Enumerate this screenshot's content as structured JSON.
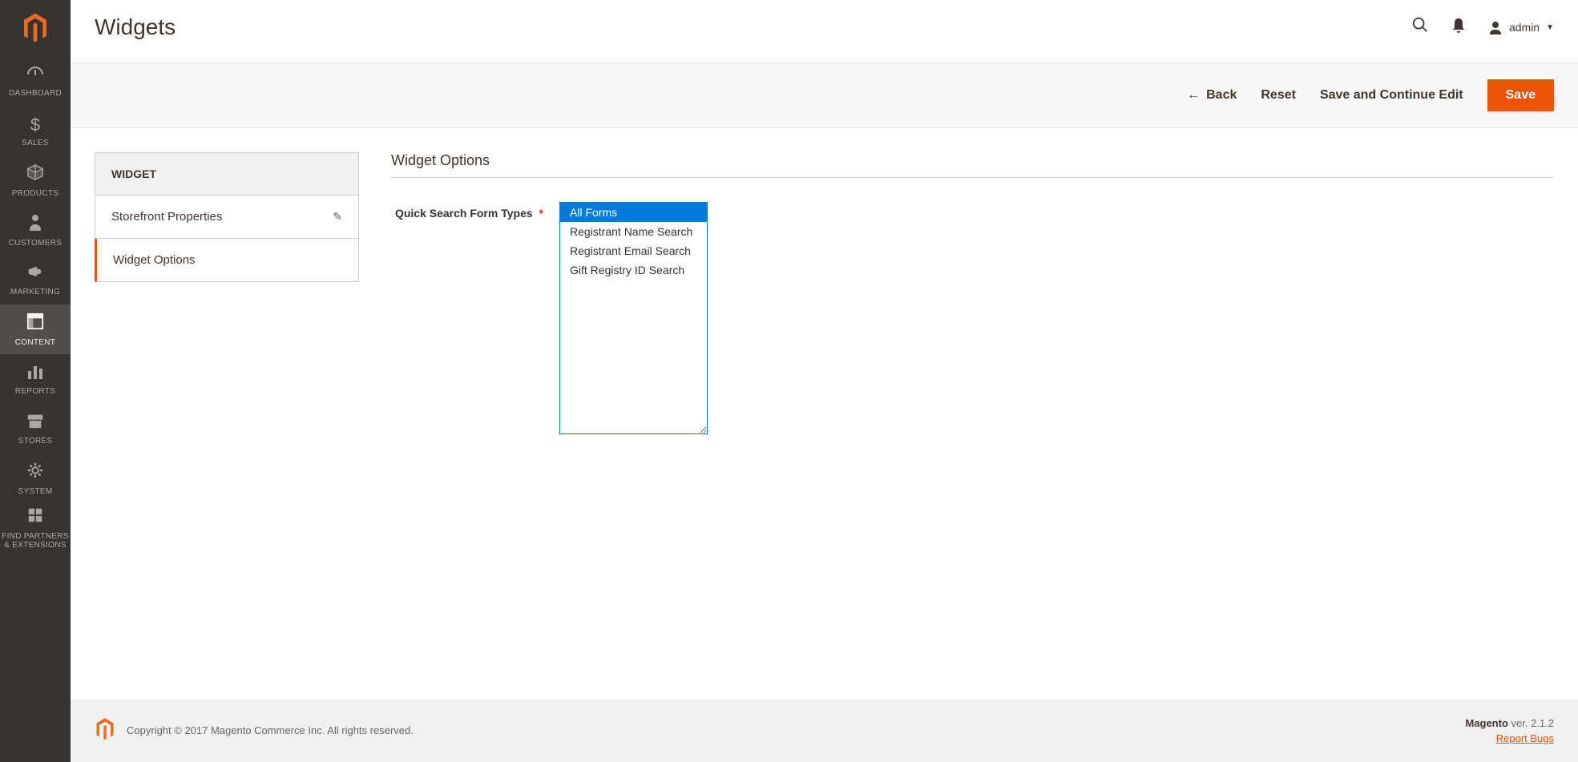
{
  "page": {
    "title": "Widgets"
  },
  "user": {
    "name": "admin"
  },
  "sidebar": {
    "items": [
      {
        "label": "DASHBOARD",
        "icon": "dashboard"
      },
      {
        "label": "SALES",
        "icon": "dollar"
      },
      {
        "label": "PRODUCTS",
        "icon": "cube"
      },
      {
        "label": "CUSTOMERS",
        "icon": "person"
      },
      {
        "label": "MARKETING",
        "icon": "megaphone"
      },
      {
        "label": "CONTENT",
        "icon": "content",
        "active": true
      },
      {
        "label": "REPORTS",
        "icon": "bars"
      },
      {
        "label": "STORES",
        "icon": "storefront"
      },
      {
        "label": "SYSTEM",
        "icon": "gear"
      },
      {
        "label": "FIND PARTNERS & EXTENSIONS",
        "icon": "blocks"
      }
    ]
  },
  "toolbar": {
    "back_label": "Back",
    "reset_label": "Reset",
    "save_continue_label": "Save and Continue Edit",
    "save_label": "Save"
  },
  "side_tabs": {
    "header": "WIDGET",
    "tabs": [
      {
        "label": "Storefront Properties",
        "editable": true
      },
      {
        "label": "Widget Options",
        "active": true
      }
    ]
  },
  "form": {
    "section_title": "Widget Options",
    "fields": {
      "quick_search": {
        "label": "Quick Search Form Types",
        "options": [
          {
            "label": "All Forms",
            "selected": true
          },
          {
            "label": "Registrant Name Search"
          },
          {
            "label": "Registrant Email Search"
          },
          {
            "label": "Gift Registry ID Search"
          }
        ]
      }
    }
  },
  "footer": {
    "copyright": "Copyright © 2017 Magento Commerce Inc. All rights reserved.",
    "product": "Magento",
    "version_prefix": " ver. ",
    "version": "2.1.2",
    "report_bugs": "Report Bugs"
  }
}
